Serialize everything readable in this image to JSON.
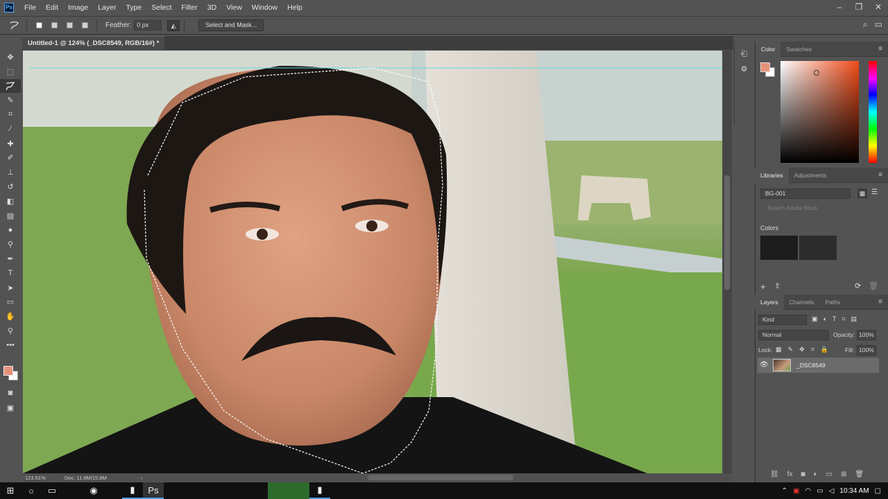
{
  "app": {
    "logo": "Ps",
    "menu": [
      "File",
      "Edit",
      "Image",
      "Layer",
      "Type",
      "Select",
      "Filter",
      "3D",
      "View",
      "Window",
      "Help"
    ],
    "window_controls": [
      "minimize-icon",
      "restore-icon",
      "close-icon"
    ]
  },
  "options": {
    "feather_label": "Feather:",
    "feather_value": "0 px",
    "select_and_mask": "Select and Mask..."
  },
  "document": {
    "tab_title": "Untitled-1 @ 124% (_DSC8549, RGB/16#) *",
    "close": "×",
    "zoom": "123.51%",
    "doc_size": "Doc: 11.9M/15.8M"
  },
  "panels": {
    "color_tabs": [
      "Color",
      "Swatches"
    ],
    "library_tabs": [
      "Libraries",
      "Adjustments"
    ],
    "library_name": "BG-001",
    "search_placeholder": "Search Adobe Stock",
    "colors_section": "Colors",
    "layer_tabs": [
      "Layers",
      "Channels",
      "Paths"
    ],
    "kind": "Kind",
    "blend_mode": "Normal",
    "opacity_label": "Opacity:",
    "opacity_value": "100%",
    "lock_label": "Lock:",
    "fill_label": "Fill:",
    "fill_value": "100%",
    "layer_name": "_DSC8549"
  },
  "colors": {
    "foreground": "#e8917a",
    "background": "#ffffff",
    "swatch_1": "#1c1c1c",
    "swatch_2": "#2c2c2c"
  },
  "taskbar": {
    "time": "10:34 AM"
  }
}
